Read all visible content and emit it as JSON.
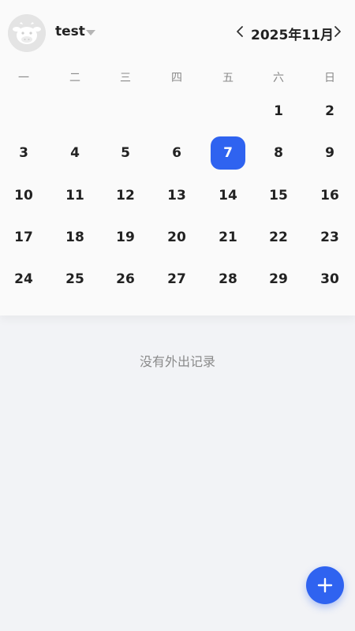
{
  "header": {
    "username": "test",
    "avatar_icon": "cow-avatar-icon",
    "month_label": "2025年11月"
  },
  "calendar": {
    "weekdays": [
      "一",
      "二",
      "三",
      "四",
      "五",
      "六",
      "日"
    ],
    "days": [
      "1",
      "2",
      "3",
      "4",
      "5",
      "6",
      "7",
      "8",
      "9",
      "10",
      "11",
      "12",
      "13",
      "14",
      "15",
      "16",
      "17",
      "18",
      "19",
      "20",
      "21",
      "22",
      "23",
      "24",
      "25",
      "26",
      "27",
      "28",
      "29",
      "30"
    ],
    "selected_day": "7",
    "accent_color": "#2f63f0"
  },
  "records": {
    "empty_message": "没有外出记录"
  },
  "fab": {
    "icon": "plus-icon"
  }
}
